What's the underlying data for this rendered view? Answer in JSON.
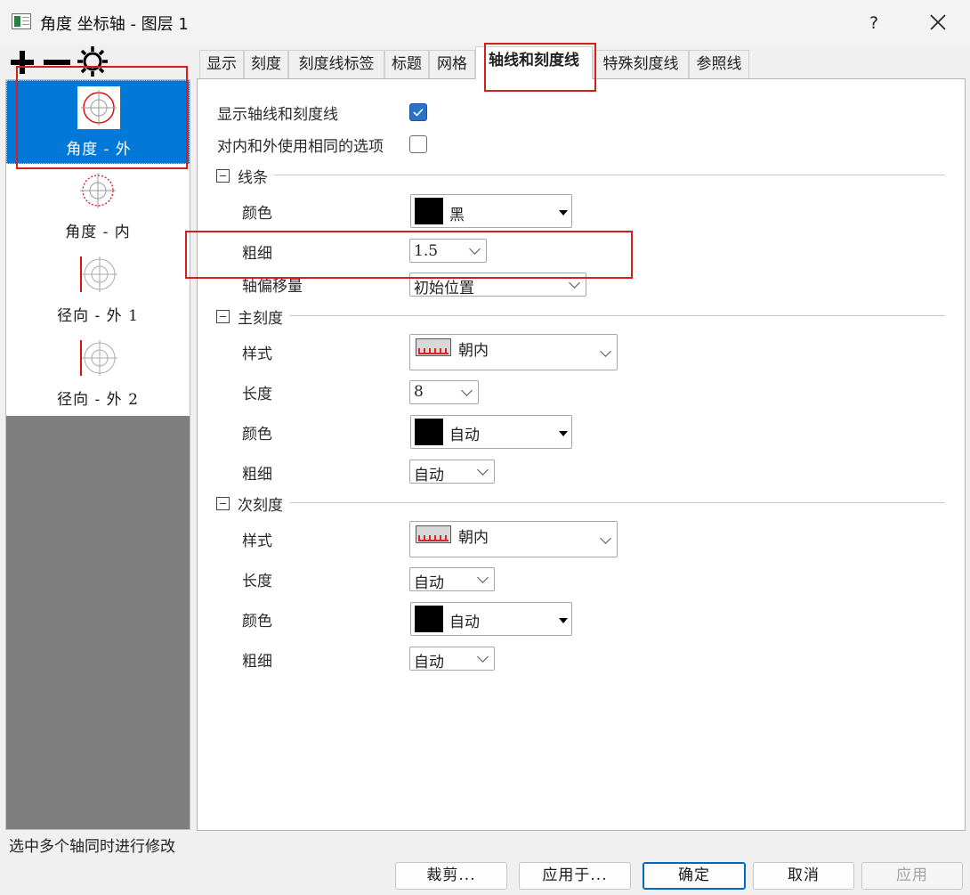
{
  "window": {
    "title": "角度 坐标轴 - 图层 1",
    "help_label": "?"
  },
  "axis_list": {
    "items": [
      {
        "label": "角度 - 外",
        "selected": true
      },
      {
        "label": "角度 - 内",
        "selected": false
      },
      {
        "label": "径向 - 外 1",
        "selected": false
      },
      {
        "label": "径向 - 外 2",
        "selected": false
      }
    ]
  },
  "tabs": [
    {
      "label": "显示"
    },
    {
      "label": "刻度"
    },
    {
      "label": "刻度线标签"
    },
    {
      "label": "标题"
    },
    {
      "label": "网格"
    },
    {
      "label": "轴线和刻度线",
      "active": true
    },
    {
      "label": "特殊刻度线"
    },
    {
      "label": "参照线"
    }
  ],
  "panel": {
    "show_axis_label": "显示轴线和刻度线",
    "show_axis_checked": true,
    "same_options_label": "对内和外使用相同的选项",
    "same_options_checked": false,
    "line_section": {
      "title": "线条",
      "color_label": "颜色",
      "color_value": "黑",
      "thickness_label": "粗细",
      "thickness_value": "1.5",
      "offset_label": "轴偏移量",
      "offset_value": "初始位置"
    },
    "major_section": {
      "title": "主刻度",
      "style_label": "样式",
      "style_value": "朝内",
      "length_label": "长度",
      "length_value": "8",
      "color_label": "颜色",
      "color_value": "自动",
      "thickness_label": "粗细",
      "thickness_value": "自动"
    },
    "minor_section": {
      "title": "次刻度",
      "style_label": "样式",
      "style_value": "朝内",
      "length_label": "长度",
      "length_value": "自动",
      "color_label": "颜色",
      "color_value": "自动",
      "thickness_label": "粗细",
      "thickness_value": "自动"
    }
  },
  "status_text": "选中多个轴同时进行修改",
  "buttons": {
    "crop": "裁剪...",
    "apply_to": "应用于...",
    "ok": "确定",
    "cancel": "取消",
    "apply": "应用"
  },
  "colors": {
    "selection": "#0078d7",
    "annotation": "#d41f1f",
    "checkbox_checked": "#2a72c8"
  },
  "icons": [
    "app-icon",
    "add-icon",
    "remove-icon",
    "settings-icon",
    "close-icon",
    "chevron-down-icon",
    "dropdown-arrow-icon",
    "tick-style-icon",
    "polar-axis-icon"
  ]
}
